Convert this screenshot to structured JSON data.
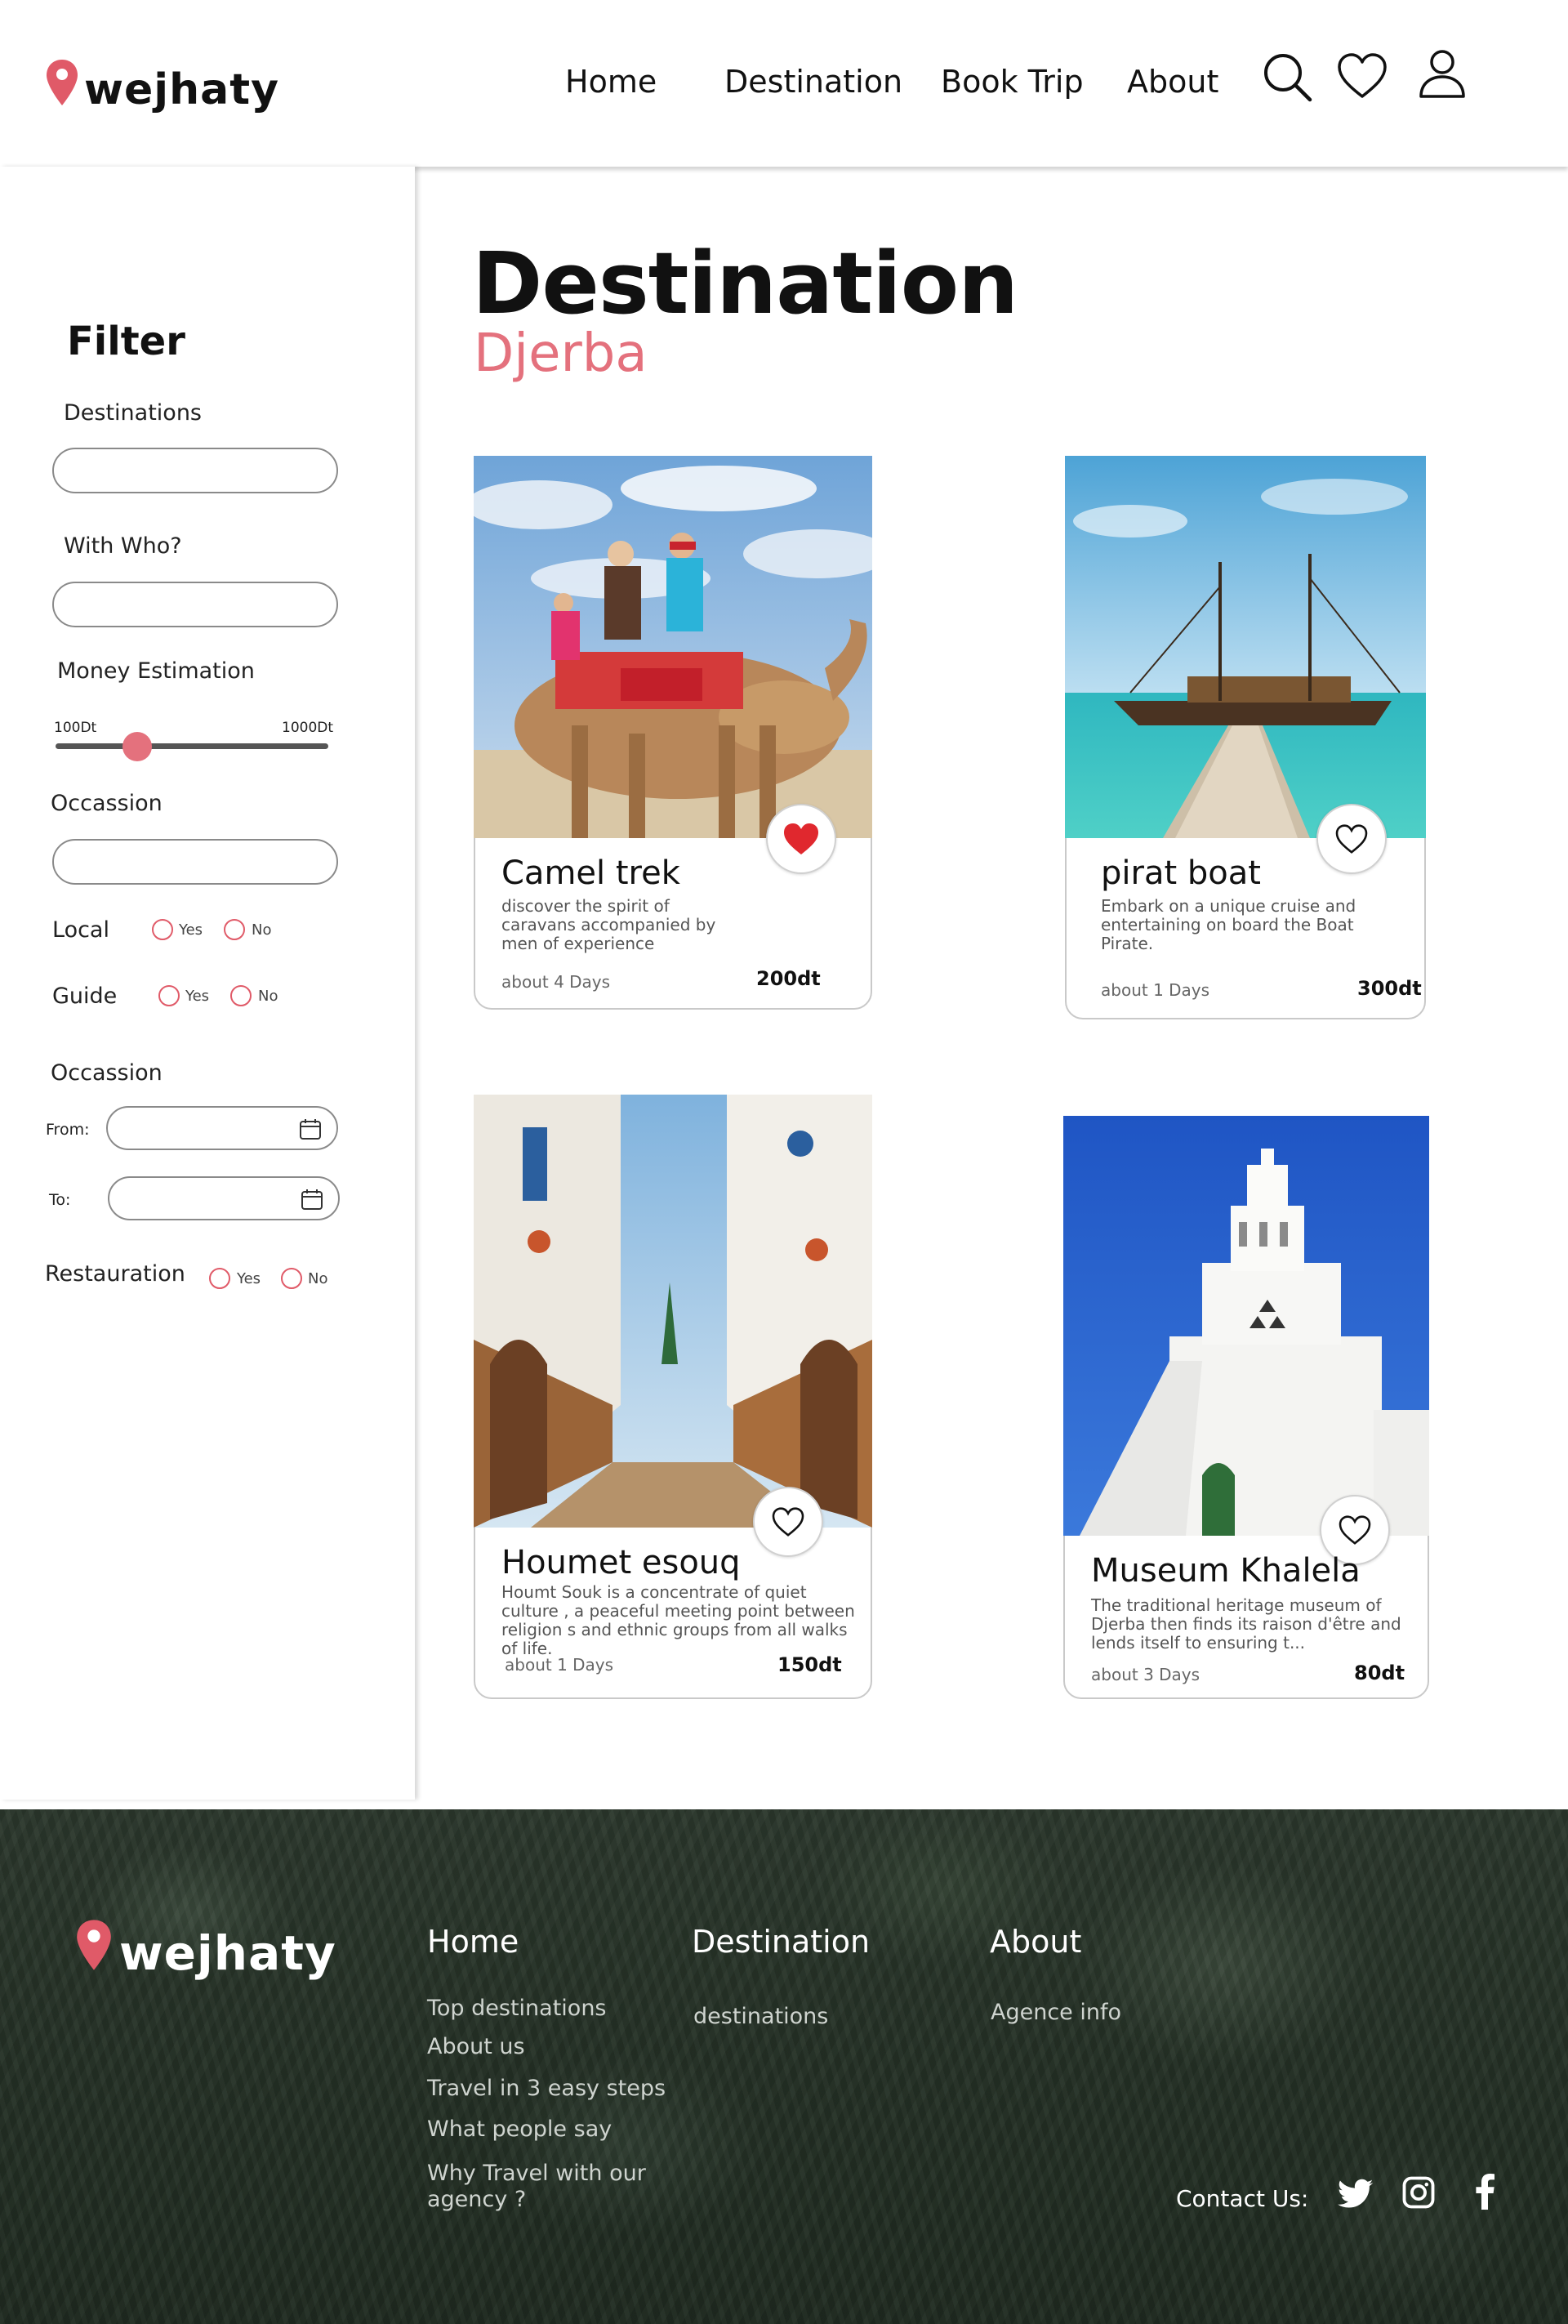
{
  "brand": {
    "name": "wejhaty",
    "accent": "#e4717d",
    "pin_color": "#e05a68"
  },
  "header": {
    "nav": [
      {
        "label": "Home"
      },
      {
        "label": "Destination"
      },
      {
        "label": "Book Trip"
      },
      {
        "label": "About"
      }
    ],
    "icons": [
      "search-icon",
      "heart-icon",
      "user-icon"
    ]
  },
  "filter": {
    "title": "Filter",
    "destinations_label": "Destinations",
    "destinations_value": "",
    "with_who_label": "With Who?",
    "with_who_value": "",
    "money_label": "Money Estimation",
    "money_min": "100Dt",
    "money_max": "1000Dt",
    "money_position": 0.3,
    "occasion_label": "Occassion",
    "occasion_value": "",
    "local_label": "Local",
    "guide_label": "Guide",
    "yes": "Yes",
    "no": "No",
    "occasion2_label": "Occassion",
    "from_label": "From:",
    "to_label": "To:",
    "restauration_label": "Restauration"
  },
  "main": {
    "title": "Destination",
    "subtitle": "Djerba",
    "cards": [
      {
        "title": "Camel trek",
        "desc": "discover the spirit of caravans accompanied by men of experience",
        "duration": "about 4 Days",
        "price": "200dt",
        "favorited": true
      },
      {
        "title": "pirat boat",
        "desc": "Embark on a unique cruise and entertaining on board the Boat Pirate.",
        "duration": "about 1 Days",
        "price": "300dt",
        "favorited": false
      },
      {
        "title": "Houmet esouq",
        "desc": "Houmt Souk is a concentrate of quiet culture , a peaceful meeting point between religion s and ethnic groups from all walks of life.",
        "duration": "about 1 Days",
        "price": "150dt",
        "favorited": false
      },
      {
        "title": "Museum Khalela",
        "desc": "The traditional heritage museum of Djerba then finds its raison d'être and lends itself to ensuring t...",
        "duration": "about 3 Days",
        "price": "80dt",
        "favorited": false
      }
    ]
  },
  "footer": {
    "home": {
      "title": "Home",
      "links": [
        "Top destinations",
        "About us",
        "Travel in 3 easy steps",
        "What people say",
        "Why Travel with our agency ?"
      ]
    },
    "destination": {
      "title": "Destination",
      "links": [
        "destinations"
      ]
    },
    "about": {
      "title": "About",
      "links": [
        "Agence info"
      ]
    },
    "contact_label": "Contact Us:",
    "social": [
      "twitter-icon",
      "instagram-icon",
      "facebook-icon"
    ]
  }
}
